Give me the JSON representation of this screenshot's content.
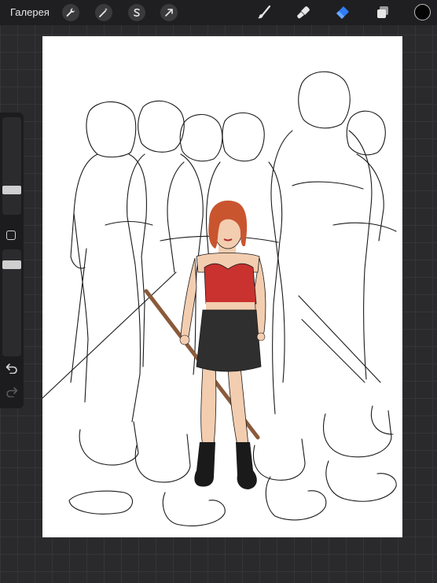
{
  "topbar": {
    "gallery_label": "Галерея",
    "tools_left": [
      "wrench-icon",
      "magic-wand-icon",
      "selection-s-icon",
      "transform-arrow-icon"
    ],
    "tools_right": [
      "brush-icon",
      "smudge-icon",
      "eraser-icon",
      "layers-icon"
    ],
    "active_tool": "eraser-icon",
    "accent_color": "#2f7cf6",
    "current_color": "#050505"
  },
  "sidebar": {
    "brush_size_level": 0.3,
    "opacity_level": 0.85,
    "controls": [
      "size-slider",
      "modify-button",
      "opacity-slider",
      "undo-icon",
      "redo-icon"
    ]
  },
  "canvas": {
    "background": "#ffffff",
    "figure_colors": {
      "hair": "#c9552f",
      "skin": "#f3cdb0",
      "top": "#c9322e",
      "skirt": "#2f2f2f",
      "staff": "#8a5a3a",
      "boots": "#1a1a1a"
    }
  }
}
